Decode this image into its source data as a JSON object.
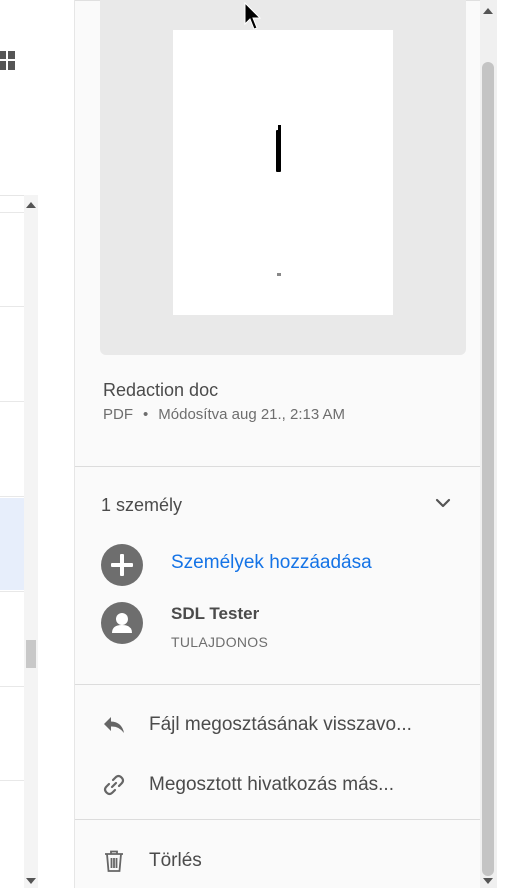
{
  "file": {
    "name": "Redaction doc",
    "type": "PDF",
    "separator": "•",
    "modified": "Módosítva aug 21., 2:13 AM"
  },
  "people": {
    "count_label": "1 személy",
    "add_label": "Személyek hozzáadása",
    "users": [
      {
        "name": "SDL Tester",
        "role": "TULAJDONOS"
      }
    ]
  },
  "actions": {
    "revoke_label": "Fájl megosztásának visszavo...",
    "copy_link_label": "Megosztott hivatkozás más...",
    "delete_label": "Törlés"
  },
  "colors": {
    "accent": "#1473e6",
    "icon_gray": "#6e6e6e",
    "text": "#4b4b4b",
    "selection": "#e7eefb"
  },
  "icons": {
    "grid": "grid-view-icon",
    "chevron": "chevron-down-icon",
    "add": "add-circle-icon",
    "avatar": "user-avatar-icon",
    "revoke": "reply-arrow-icon",
    "link": "link-icon",
    "delete": "trash-icon"
  }
}
